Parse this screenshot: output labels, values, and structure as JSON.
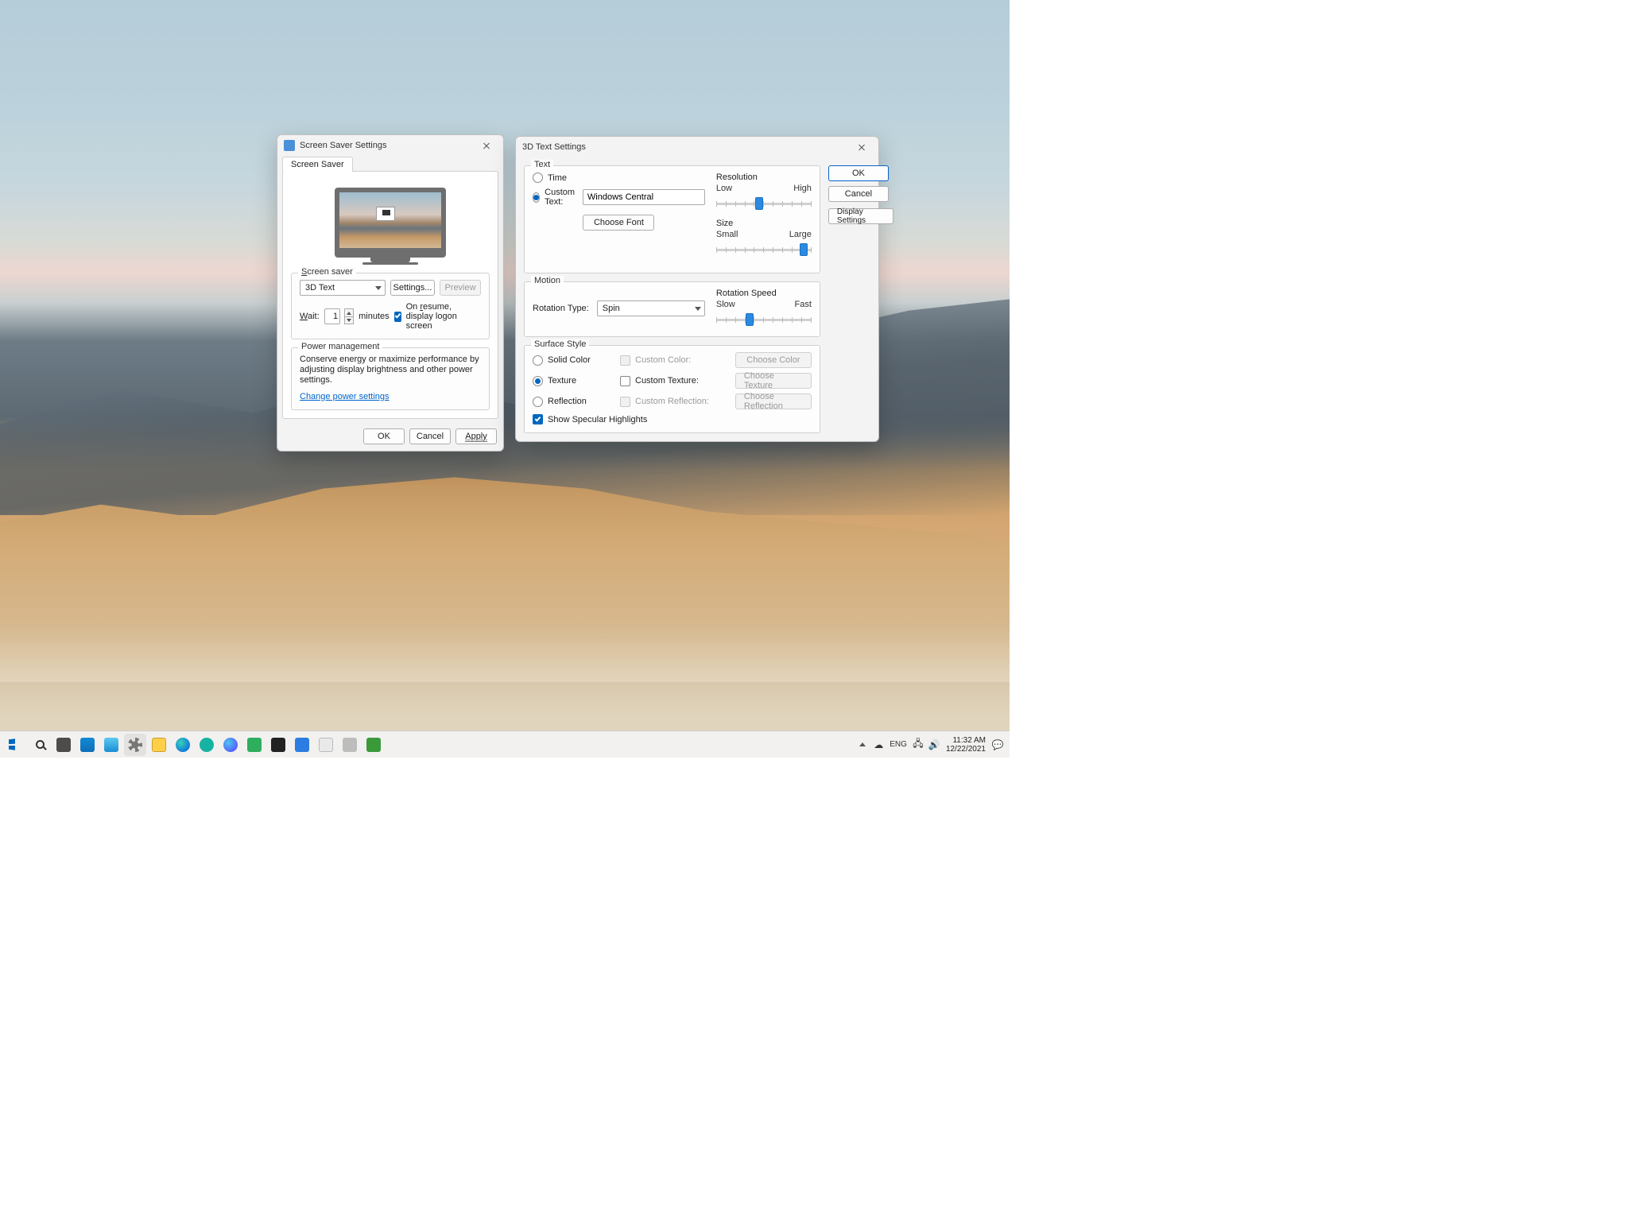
{
  "screensaver_dialog": {
    "title": "Screen Saver Settings",
    "tab": "Screen Saver",
    "group_saver": {
      "legend": "Screen saver",
      "selected": "3D Text",
      "settings_btn": "Settings...",
      "preview_btn": "Preview",
      "wait_label_pre": "Wait:",
      "wait_value": "1",
      "wait_label_post": "minutes",
      "on_resume_checked": true,
      "on_resume_label": "On resume, display logon screen"
    },
    "group_power": {
      "legend": "Power management",
      "text": "Conserve energy or maximize performance by adjusting display brightness and other power settings.",
      "link": "Change power settings"
    },
    "buttons": {
      "ok": "OK",
      "cancel": "Cancel",
      "apply": "Apply"
    }
  },
  "text3d_dialog": {
    "title": "3D Text Settings",
    "sections": {
      "text": {
        "legend": "Text",
        "time_label": "Time",
        "custom_label": "Custom Text:",
        "custom_value": "Windows Central",
        "choose_font": "Choose Font",
        "resolution": {
          "label": "Resolution",
          "low": "Low",
          "high": "High",
          "pos": 45
        },
        "size": {
          "label": "Size",
          "small": "Small",
          "large": "Large",
          "pos": 92
        }
      },
      "motion": {
        "legend": "Motion",
        "rotation_type_label": "Rotation Type:",
        "rotation_type_value": "Spin",
        "speed": {
          "label": "Rotation Speed",
          "slow": "Slow",
          "fast": "Fast",
          "pos": 35
        }
      },
      "surface": {
        "legend": "Surface Style",
        "solid": "Solid Color",
        "texture": "Texture",
        "reflection": "Reflection",
        "custom_color": "Custom Color:",
        "custom_texture": "Custom Texture:",
        "custom_reflection": "Custom Reflection:",
        "choose_color": "Choose Color",
        "choose_texture": "Choose Texture",
        "choose_reflection": "Choose Reflection",
        "specular_checked": true,
        "specular_label": "Show Specular Highlights"
      }
    },
    "buttons": {
      "ok": "OK",
      "cancel": "Cancel",
      "display": "Display Settings"
    }
  },
  "taskbar": {
    "tray": {
      "lang": "ENG",
      "time": "11:32 AM",
      "date": "12/22/2021"
    }
  }
}
